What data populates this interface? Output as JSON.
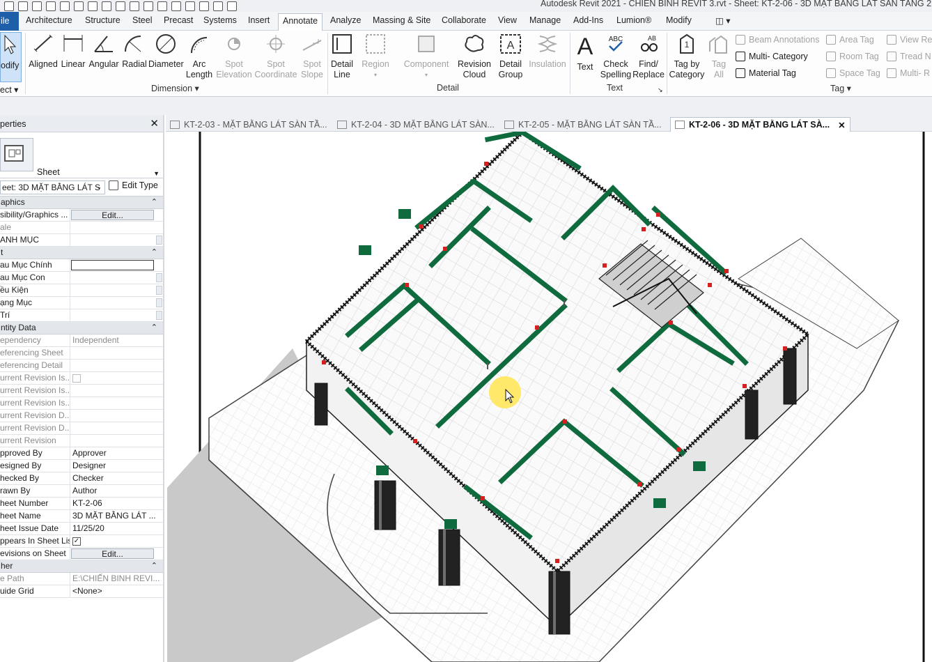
{
  "app_title": "Autodesk Revit 2021 - CHIẾN BINH REVIT 3.rvt - Sheet: KT-2-06 - 3D MẶT BẰNG LÁT SÀN TẦNG 2",
  "ribbon_tabs": [
    "ile",
    "Architecture",
    "Structure",
    "Steel",
    "Precast",
    "Systems",
    "Insert",
    "Annotate",
    "Analyze",
    "Massing & Site",
    "Collaborate",
    "View",
    "Manage",
    "Add-Ins",
    "Lumion®",
    "Modify"
  ],
  "active_tab": "Annotate",
  "ribbon": {
    "modify_label": "odify",
    "select_label": "ect",
    "dimension": {
      "buttons": [
        "Aligned",
        "Linear",
        "Angular",
        "Radial",
        "Diameter",
        "Arc Length",
        "Spot Elevation",
        "Spot Coordinate",
        "Spot Slope"
      ],
      "label": "Dimension"
    },
    "detail": {
      "buttons": [
        "Detail Line",
        "Region",
        "Component",
        "Revision Cloud",
        "Detail Group",
        "Insulation"
      ],
      "label": "Detail"
    },
    "text": {
      "buttons": [
        "Text",
        "Check Spelling",
        "Find/ Replace"
      ],
      "label": "Text"
    },
    "tag": {
      "buttons": [
        "Tag by Category",
        "Tag All"
      ],
      "small": [
        "Beam  Annotations",
        "Multi- Category",
        "Material  Tag",
        "Area  Tag",
        "Room  Tag",
        "Space  Tag",
        "View  Re",
        "Tread  N",
        "Multi- R"
      ],
      "label": "Tag"
    }
  },
  "properties": {
    "title": "perties",
    "type_name": "Sheet",
    "instance_selector": "eet: 3D MẶT BẰNG LÁT S",
    "edit_type": "Edit Type",
    "sections": [
      {
        "name": "aphics",
        "rows": [
          {
            "k": "sibility/Graphics ...",
            "v": "Edit...",
            "kind": "btn"
          },
          {
            "k": "ale",
            "v": "",
            "kind": "ro"
          },
          {
            "k": "ANH MỤC",
            "v": "",
            "kind": "sb"
          }
        ]
      },
      {
        "name": "t",
        "rows": [
          {
            "k": "au Mục Chính",
            "v": "",
            "kind": "box"
          },
          {
            "k": "au Mục Con",
            "v": "",
            "kind": "sb"
          },
          {
            "k": "ều Kiện",
            "v": "",
            "kind": "sb"
          },
          {
            "k": "ạng Mục",
            "v": "",
            "kind": "sb"
          },
          {
            "k": " Trí",
            "v": "",
            "kind": "sb"
          }
        ]
      },
      {
        "name": "ntity Data",
        "rows": [
          {
            "k": "ependency",
            "v": "Independent",
            "kind": "ro"
          },
          {
            "k": "eferencing Sheet",
            "v": "",
            "kind": "ro"
          },
          {
            "k": "eferencing Detail",
            "v": "",
            "kind": "ro"
          },
          {
            "k": "urrent Revision Is...",
            "v": "",
            "kind": "rochk"
          },
          {
            "k": "urrent Revision Is...",
            "v": "",
            "kind": "ro"
          },
          {
            "k": "urrent Revision Is...",
            "v": "",
            "kind": "ro"
          },
          {
            "k": "urrent Revision D...",
            "v": "",
            "kind": "ro"
          },
          {
            "k": "urrent Revision D...",
            "v": "",
            "kind": "ro"
          },
          {
            "k": "urrent Revision",
            "v": "",
            "kind": "ro"
          },
          {
            "k": "pproved By",
            "v": "Approver",
            "kind": "txt"
          },
          {
            "k": "esigned By",
            "v": "Designer",
            "kind": "txt"
          },
          {
            "k": "hecked By",
            "v": "Checker",
            "kind": "txt"
          },
          {
            "k": "rawn By",
            "v": "Author",
            "kind": "txt"
          },
          {
            "k": "heet Number",
            "v": "KT-2-06",
            "kind": "txt"
          },
          {
            "k": "heet Name",
            "v": "3D MẶT BẰNG LÁT ...",
            "kind": "txt"
          },
          {
            "k": "heet Issue Date",
            "v": "11/25/20",
            "kind": "txt"
          },
          {
            "k": "ppears In Sheet List",
            "v": "✓",
            "kind": "chk"
          },
          {
            "k": "evisions on Sheet",
            "v": "Edit...",
            "kind": "btn"
          }
        ]
      },
      {
        "name": "her",
        "rows": [
          {
            "k": "e Path",
            "v": "E:\\CHIẾN BINH REVI...",
            "kind": "ro"
          },
          {
            "k": "uide Grid",
            "v": "<None>",
            "kind": "txt"
          }
        ]
      }
    ]
  },
  "doc_tabs": [
    {
      "label": "KT-2-03 - MẶT BẰNG LÁT SÀN TẦ...",
      "active": false
    },
    {
      "label": "KT-2-04 - 3D MẶT BẰNG LÁT SÀN...",
      "active": false
    },
    {
      "label": "KT-2-05 - MẶT BẰNG LÁT SÀN TẦ...",
      "active": false
    },
    {
      "label": "KT-2-06 - 3D MẶT BẰNG LÁT SÀ...",
      "active": true
    }
  ],
  "colors": {
    "wall_green": "#0f6b3e",
    "column_red": "#d61f1f",
    "accent_blue": "#1f5ea8"
  }
}
